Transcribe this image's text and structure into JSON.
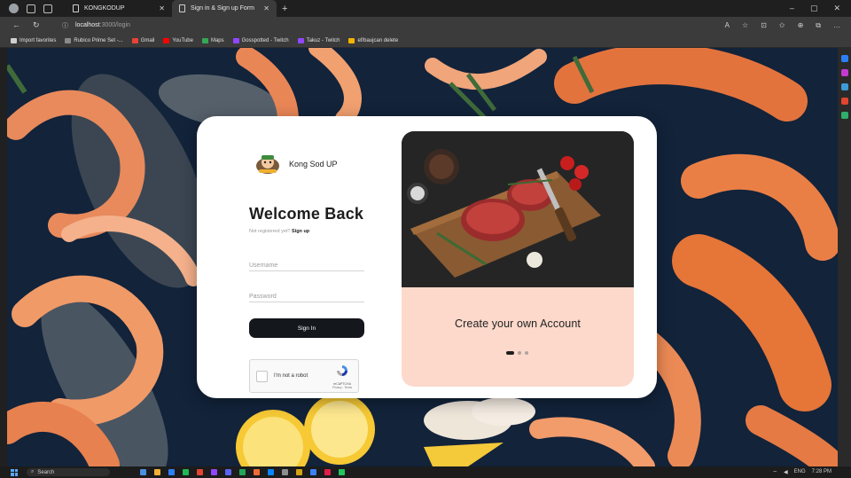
{
  "browser": {
    "tabs": [
      {
        "title": "KONGKODUP",
        "active": false
      },
      {
        "title": "Sign in & Sign up Form",
        "active": true
      }
    ],
    "new_tab": "+",
    "window_controls": [
      "–",
      "▢",
      "✕"
    ],
    "address": {
      "host": "localhost",
      "path": ":3000/login"
    },
    "favorites": [
      {
        "label": "Import favorites",
        "color": "#cfcfcf"
      },
      {
        "label": "Rubico Prime Set -...",
        "color": "#8a8a8a"
      },
      {
        "label": "Gmail",
        "color": "#ea4335"
      },
      {
        "label": "YouTube",
        "color": "#ff0000"
      },
      {
        "label": "Maps",
        "color": "#34a853"
      },
      {
        "label": "Gosspotted - Twitch",
        "color": "#9146ff"
      },
      {
        "label": "Takuz - Twitch",
        "color": "#9146ff"
      },
      {
        "label": "ef/baujcan delete",
        "color": "#f4b400"
      }
    ]
  },
  "login": {
    "brand": "Kong Sod UP",
    "title": "Welcome Back",
    "not_registered": "Not registered yet?",
    "signup_link": "Sign up",
    "username_placeholder": "Username",
    "password_placeholder": "Password",
    "signin_label": "Sign In",
    "captcha": {
      "label": "I'm not a robot",
      "brand": "reCAPTCHA",
      "links": "Privacy - Terms"
    }
  },
  "promo": {
    "title": "Create your own Account",
    "slides": 3,
    "active_slide": 1
  },
  "colors": {
    "card_bg": "#ffffff",
    "promo_bg": "#fcd9cb",
    "button_bg": "#14171b",
    "page_bg": "#122033"
  },
  "taskbar": {
    "search_placeholder": "Search",
    "tray_lang": "ENG",
    "time": "7:28 PM"
  }
}
